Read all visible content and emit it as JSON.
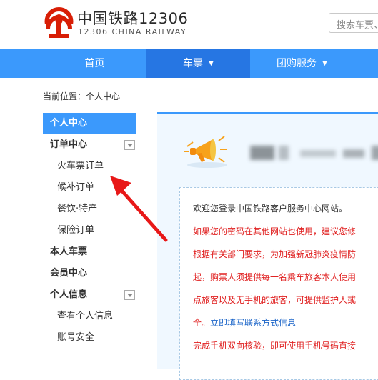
{
  "header": {
    "brand_cn": "中国铁路12306",
    "brand_en": "12306 CHINA RAILWAY",
    "search_placeholder": "搜索车票、"
  },
  "nav": {
    "items": [
      {
        "label": "首页"
      },
      {
        "label": "车票"
      },
      {
        "label": "团购服务"
      }
    ]
  },
  "breadcrumb": "当前位置：个人中心",
  "sidebar": {
    "active": "个人中心",
    "order_center": "订单中心",
    "orders": [
      "火车票订单",
      "候补订单",
      "餐饮·特产",
      "保险订单"
    ],
    "my_tickets": "本人车票",
    "member_center": "会员中心",
    "personal_info": "个人信息",
    "info_items": [
      "查看个人信息",
      "账号安全"
    ]
  },
  "notice": {
    "welcome": "欢迎您登录中国铁路客户服务中心网站。",
    "line1": "如果您的密码在其他网站也使用，建议您修",
    "line2": "根据有关部门要求，为加强新冠肺炎疫情防",
    "line3": "起，购票人须提供每一名乘车旅客本人使用",
    "line4": "点旅客以及无手机的旅客，可提供监护人或",
    "line5_prefix": "全。",
    "line5_link": "立即填写联系方式信息",
    "line6": "完成手机双向核验，即可使用手机号码直接"
  },
  "colors": {
    "nav_bg": "#3b99fc",
    "nav_active": "#2676e3",
    "brand_red": "#d81e06",
    "notice_red": "#e02020",
    "link_blue": "#1a64c8"
  }
}
